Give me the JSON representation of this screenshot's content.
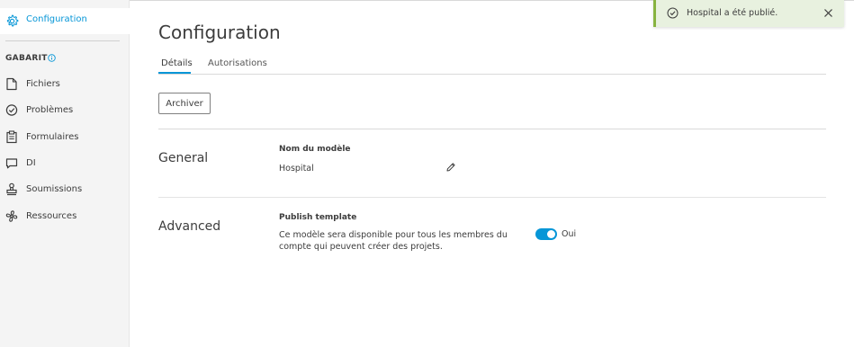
{
  "sidebar": {
    "active_item": {
      "label": "Configuration",
      "icon": "gear-icon"
    },
    "section_label": "GABARIT",
    "items": [
      {
        "label": "Fichiers",
        "icon": "file-icon"
      },
      {
        "label": "Problèmes",
        "icon": "check-circle-icon"
      },
      {
        "label": "Formulaires",
        "icon": "clipboard-icon"
      },
      {
        "label": "DI",
        "icon": "chat-icon"
      },
      {
        "label": "Soumissions",
        "icon": "stamp-icon"
      },
      {
        "label": "Ressources",
        "icon": "fan-icon"
      }
    ]
  },
  "main": {
    "title": "Configuration",
    "tabs": [
      {
        "label": "Détails",
        "active": true
      },
      {
        "label": "Autorisations",
        "active": false
      }
    ],
    "archive_button": "Archiver",
    "general": {
      "title": "General",
      "field_label": "Nom du modèle",
      "field_value": "Hospital"
    },
    "advanced": {
      "title": "Advanced",
      "field_label": "Publish template",
      "description": "Ce modèle sera disponible pour tous les membres du compte qui peuvent créer des projets.",
      "toggle_on": true,
      "toggle_label": "Oui"
    }
  },
  "toast": {
    "message": "Hospital a été publié."
  },
  "colors": {
    "accent": "#0696d7",
    "success_border": "#87b340",
    "success_bg": "#e8f1df"
  }
}
